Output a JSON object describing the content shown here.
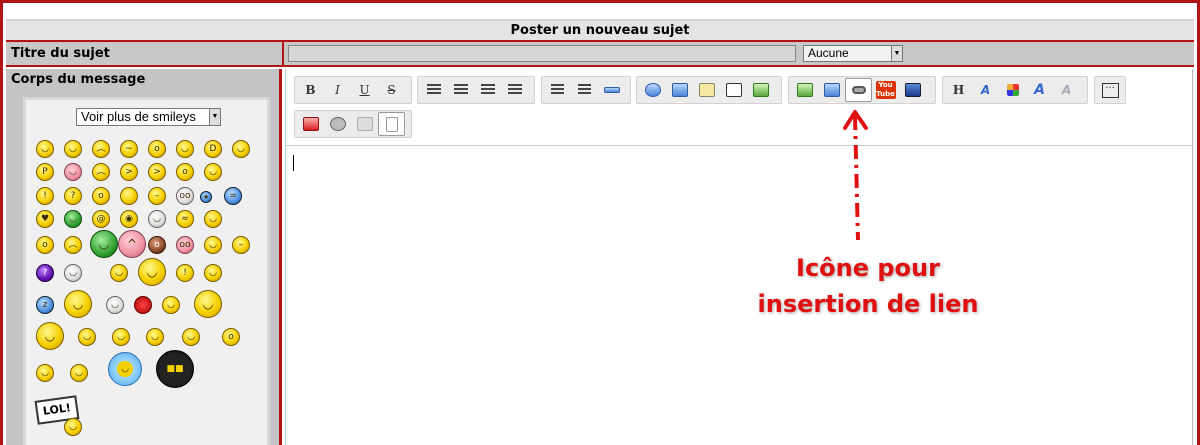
{
  "header": {
    "title": "Poster un nouveau sujet"
  },
  "subject": {
    "label": "Titre du sujet",
    "input_value": "",
    "icon_select": "Aucune"
  },
  "message": {
    "label": "Corps du message"
  },
  "smileys": {
    "more_select": "Voir plus de smileys",
    "lol_sign_text": "LOL!"
  },
  "toolbar": {
    "buttons": [
      "bold-button",
      "italic-button",
      "underline-button",
      "strike-button",
      "align-left-button",
      "align-center-button",
      "align-right-button",
      "justify-button",
      "bullet-list-button",
      "numbered-list-button",
      "horizontal-rule-button",
      "quote-button",
      "code-button",
      "spoiler-button",
      "hide-button",
      "table-button",
      "image-button",
      "image-host-button",
      "link-button",
      "youtube-button",
      "flash-button",
      "heading-button",
      "font-button",
      "color-button",
      "font-style-button",
      "clear-format-button",
      "more-button",
      "date-button",
      "media-button",
      "paste-button",
      "source-button"
    ],
    "glyphs": {
      "bold": "B",
      "italic": "I",
      "underline": "U",
      "strike": "S",
      "heading": "H",
      "font": "A",
      "youtube": "You Tube",
      "more": "···"
    }
  },
  "annotation": {
    "text": "Icône pour insertion de lien",
    "color": "#e01010"
  },
  "colors": {
    "border_accent": "#b01414",
    "panel_grey": "#c4c4c4"
  }
}
